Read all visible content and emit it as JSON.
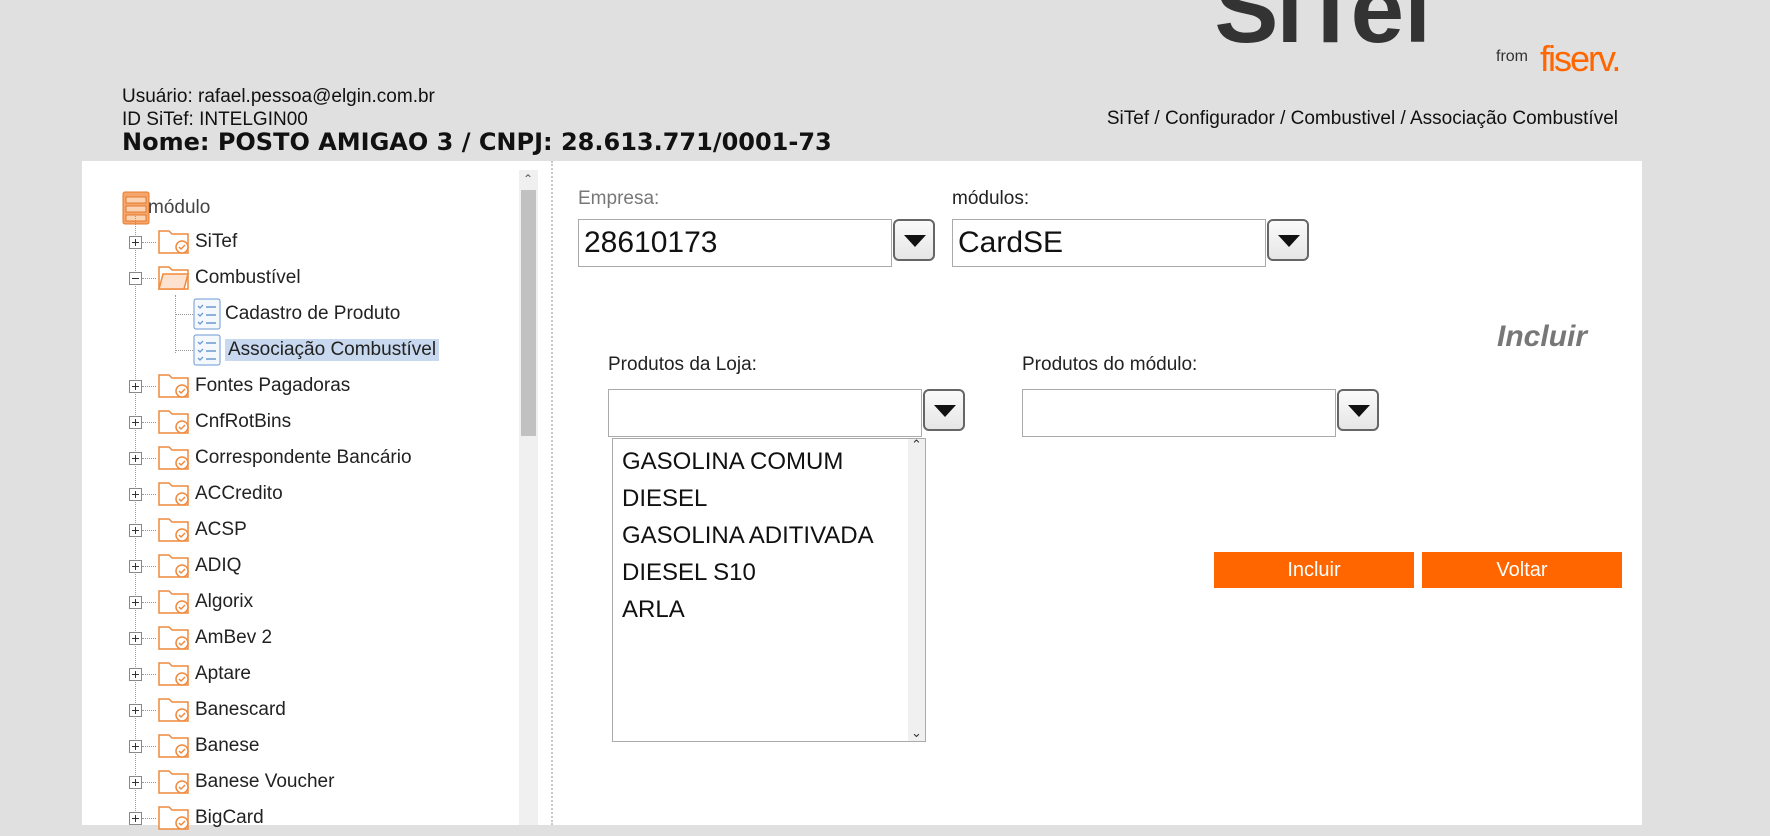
{
  "brand": {
    "logo_text": "SiTef",
    "from_text": "from",
    "fiserv_text": "fiserv."
  },
  "header": {
    "user": "Usuário: rafael.pessoa@elgin.com.br",
    "id": "ID SiTef: INTELGIN00",
    "nome": "Nome: POSTO AMIGAO 3 / CNPJ: 28.613.771/0001-73",
    "breadcrumb": "SiTef / Configurador / Combustivel / Associação Combustível"
  },
  "tree": {
    "root": "módulo",
    "items": [
      {
        "label": "SiTef",
        "expander": "plus"
      },
      {
        "label": "Combustível",
        "expander": "minus"
      },
      {
        "label": "Cadastro de Produto",
        "expander": "none"
      },
      {
        "label": "Associação Combustível",
        "expander": "none",
        "selected": true
      },
      {
        "label": "Fontes Pagadoras",
        "expander": "plus"
      },
      {
        "label": "CnfRotBins",
        "expander": "plus"
      },
      {
        "label": "Correspondente Bancário",
        "expander": "plus"
      },
      {
        "label": "ACCredito",
        "expander": "plus"
      },
      {
        "label": "ACSP",
        "expander": "plus"
      },
      {
        "label": "ADIQ",
        "expander": "plus"
      },
      {
        "label": "Algorix",
        "expander": "plus"
      },
      {
        "label": "AmBev 2",
        "expander": "plus"
      },
      {
        "label": "Aptare",
        "expander": "plus"
      },
      {
        "label": "Banescard",
        "expander": "plus"
      },
      {
        "label": "Banese",
        "expander": "plus"
      },
      {
        "label": "Banese Voucher",
        "expander": "plus"
      },
      {
        "label": "BigCard",
        "expander": "plus"
      }
    ]
  },
  "form": {
    "empresa_label": "Empresa:",
    "empresa_value": "28610173",
    "modulos_label": "módulos:",
    "modulos_value": "CardSE",
    "incluir_title": "Incluir",
    "produtos_loja_label": "Produtos da Loja:",
    "produtos_loja_value": "",
    "produtos_modulo_label": "Produtos do módulo:",
    "produtos_modulo_value": "",
    "produtos_list": [
      "GASOLINA COMUM",
      "DIESEL",
      "GASOLINA ADITIVADA",
      "DIESEL S10",
      "ARLA"
    ],
    "incluir_button": "Incluir",
    "voltar_button": "Voltar"
  },
  "colors": {
    "accent": "#ff6600",
    "selected_bg": "#c8d8ee",
    "folder": "#f08a3c"
  }
}
